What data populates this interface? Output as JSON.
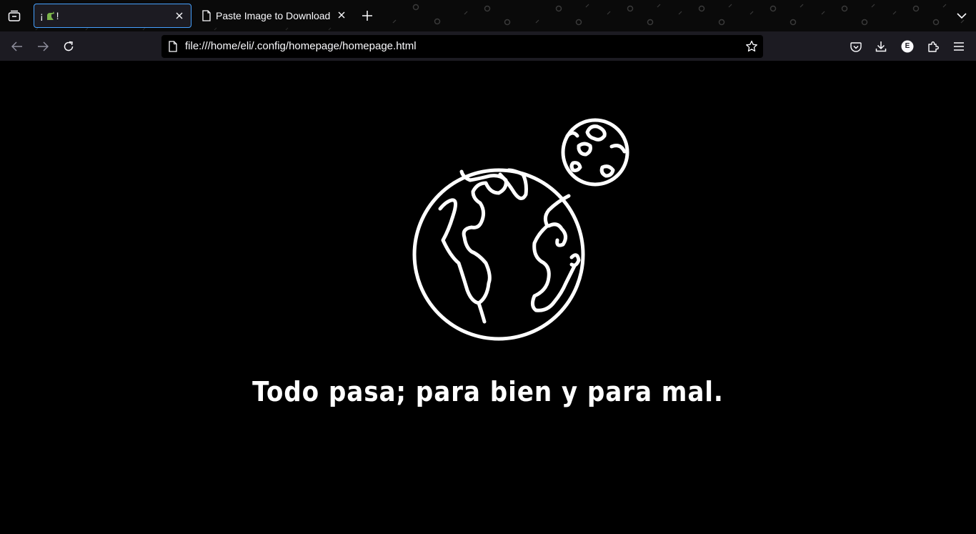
{
  "browser": {
    "tabs": [
      {
        "label": "¡",
        "favicon": "dinosaur-icon",
        "suffix": " !",
        "active": true
      },
      {
        "label": "Paste Image to Download",
        "favicon": "page-icon",
        "active": false
      }
    ],
    "url": "file:///home/eli/.config/homepage/homepage.html",
    "toolbar_icons": [
      "back-icon",
      "forward-icon",
      "reload-icon",
      "pocket-icon",
      "download-icon",
      "account-icon",
      "extensions-icon",
      "menu-icon"
    ],
    "account_initial": "E"
  },
  "page": {
    "quote": "Todo pasa; para bien y para mal.",
    "illustration": "earth-and-moon-icon"
  },
  "colors": {
    "accent": "#45a1ff",
    "toolbar": "#1c1b22",
    "background": "#000000",
    "text": "#fbfbfe"
  }
}
